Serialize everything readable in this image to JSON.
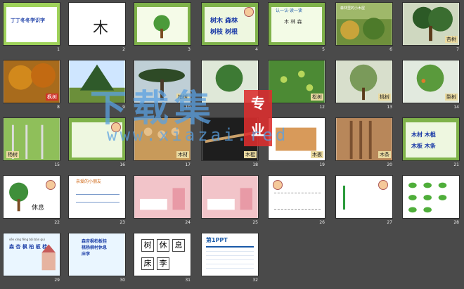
{
  "slides": [
    {
      "n": "1",
      "title": "丁丁冬冬学识字",
      "subtitle": "",
      "caption": ""
    },
    {
      "n": "2",
      "glyph": "木"
    },
    {
      "n": "3",
      "header": ""
    },
    {
      "n": "4",
      "words": [
        "树木 森林",
        "树枝 树根"
      ]
    },
    {
      "n": "5",
      "header": "认一认·读一读",
      "word": "木 林 森"
    },
    {
      "n": "6",
      "header": "森林里的小木屋"
    },
    {
      "n": "7",
      "caption": "杏树"
    },
    {
      "n": "8",
      "caption": "枫树"
    },
    {
      "n": "9",
      "caption": ""
    },
    {
      "n": "10",
      "caption": "柏树"
    },
    {
      "n": "11",
      "caption": ""
    },
    {
      "n": "12",
      "caption": "松树"
    },
    {
      "n": "13",
      "caption": "桃树"
    },
    {
      "n": "14",
      "caption": "梨树"
    },
    {
      "n": "15",
      "caption": "杨树"
    },
    {
      "n": "16",
      "header": ""
    },
    {
      "n": "17",
      "caption": "木材"
    },
    {
      "n": "18",
      "caption": "木棍"
    },
    {
      "n": "19",
      "caption": "木板"
    },
    {
      "n": "20",
      "caption": "木条"
    },
    {
      "n": "21",
      "words": [
        "木材 木棍",
        "木板 木条"
      ]
    },
    {
      "n": "22",
      "glyph": "休息"
    },
    {
      "n": "23",
      "header": "亲爱的小朋友"
    },
    {
      "n": "24",
      "caption": ""
    },
    {
      "n": "25",
      "header": ""
    },
    {
      "n": "26",
      "header": ""
    },
    {
      "n": "27",
      "header": ""
    },
    {
      "n": "28",
      "header": ""
    },
    {
      "n": "29",
      "line1": "sēn xìng fēng bǎi bǎn guì",
      "line2": "森 杏 枫 柏 板 桂"
    },
    {
      "n": "30",
      "line1": "森杏枫柏板桂",
      "line2": "桃杨柳村休息",
      "line3": "床李"
    },
    {
      "n": "31",
      "chars": [
        "树",
        "休",
        "息",
        "床",
        "李"
      ]
    },
    {
      "n": "32",
      "logo": "第1PPT"
    }
  ],
  "watermark": {
    "main": "下载集",
    "badge1": "专",
    "badge2": "业",
    "url": "www.xiazai.red"
  },
  "colors": {
    "background": "#4a4a4a",
    "vine": "#7fb24a",
    "accent_blue": "#1a3aa8",
    "cap_tag": "#eadaa0",
    "cap_red": "#d0322a"
  }
}
